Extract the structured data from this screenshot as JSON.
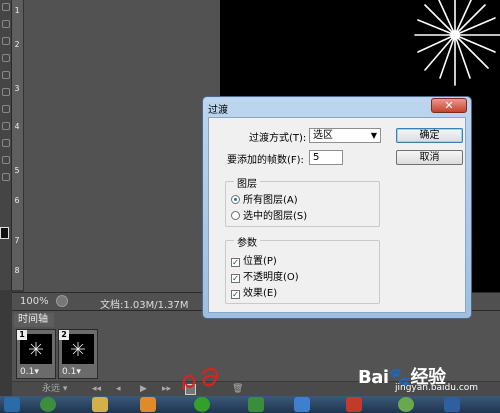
{
  "ruler": {
    "numbers": [
      "1",
      "2",
      "3",
      "4",
      "5",
      "6",
      "7",
      "8"
    ]
  },
  "status": {
    "zoom": "100%",
    "doc_info": "文档:1.03M/1.37M"
  },
  "timeline": {
    "tab_label": "时间轴",
    "frames": [
      {
        "number": "1",
        "delay": "0.1▾"
      },
      {
        "number": "2",
        "delay": "0.1▾"
      }
    ],
    "controls": {
      "loop": "永远 ▾",
      "first": "◂◂",
      "prev": "◂",
      "play": "▶",
      "next": "▸▸",
      "delete": "🗑"
    }
  },
  "dialog": {
    "title": "过渡",
    "close": "✕",
    "method_label": "过渡方式(T):",
    "method_value": "选区",
    "frames_label": "要添加的帧数(F):",
    "frames_value": "5",
    "ok": "确定",
    "cancel": "取消",
    "layers_group": {
      "title": "图层",
      "options": [
        {
          "label": "所有图层(A)",
          "selected": true
        },
        {
          "label": "选中的图层(S)",
          "selected": false
        }
      ]
    },
    "params_group": {
      "title": "参数",
      "options": [
        {
          "label": "位置(P)",
          "checked": true
        },
        {
          "label": "不透明度(O)",
          "checked": true
        },
        {
          "label": "效果(E)",
          "checked": true
        }
      ]
    }
  },
  "watermark": {
    "logo": "Bai🐾经验",
    "url": "jingyan.baidu.com"
  }
}
